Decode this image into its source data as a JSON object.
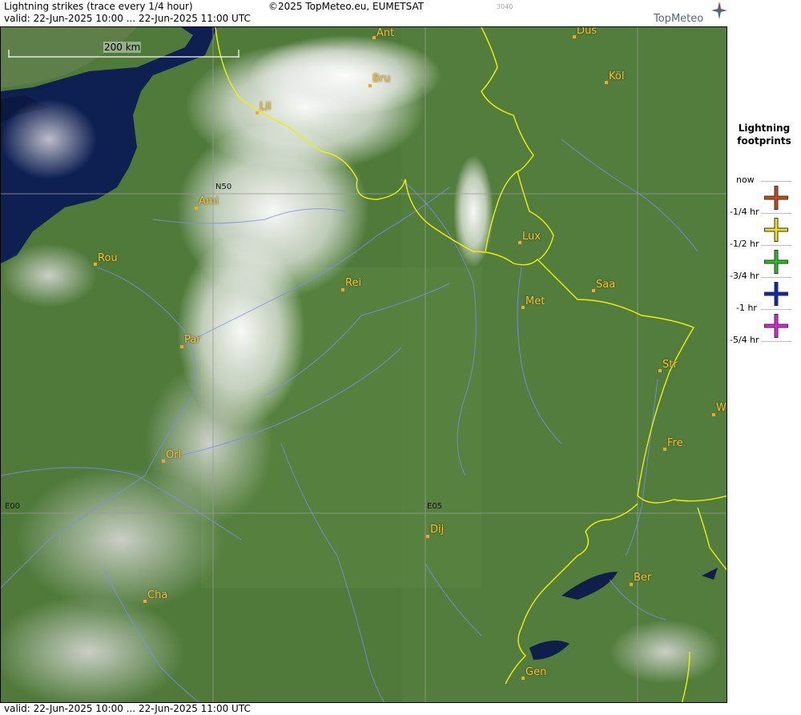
{
  "header": {
    "title": "Lightning strikes (trace every 1/4 hour)",
    "valid": "valid:  22-Jun-2025 10:00 ... 22-Jun-2025 11:00 UTC",
    "copyright": "©2025 TopMeteo.eu, EUMETSAT",
    "code": "3040",
    "brand": "TopMeteo"
  },
  "footer": {
    "valid": "valid:  22-Jun-2025 10:00 ... 22-Jun-2025 11:00 UTC"
  },
  "map": {
    "scale_label": "200 km",
    "grid_labels": {
      "n50": "N50",
      "e00": "E00",
      "e05": "E05"
    },
    "cities": [
      {
        "name": "Ant",
        "key": "ant"
      },
      {
        "name": "Düs",
        "key": "dus"
      },
      {
        "name": "Köl",
        "key": "kol"
      },
      {
        "name": "Bru",
        "key": "bru"
      },
      {
        "name": "Lil",
        "key": "lil"
      },
      {
        "name": "Ami",
        "key": "ami"
      },
      {
        "name": "Rou",
        "key": "rou"
      },
      {
        "name": "Lux",
        "key": "lux"
      },
      {
        "name": "Rei",
        "key": "rei"
      },
      {
        "name": "Saa",
        "key": "saa"
      },
      {
        "name": "Met",
        "key": "met"
      },
      {
        "name": "Par",
        "key": "par"
      },
      {
        "name": "Str",
        "key": "str"
      },
      {
        "name": "W",
        "key": "w"
      },
      {
        "name": "Fre",
        "key": "fre"
      },
      {
        "name": "Orl",
        "key": "orl"
      },
      {
        "name": "Dij",
        "key": "dij"
      },
      {
        "name": "Ber",
        "key": "ber"
      },
      {
        "name": "Cha",
        "key": "cha"
      },
      {
        "name": "Gen",
        "key": "gen"
      }
    ]
  },
  "legend": {
    "title_line1": "Lightning",
    "title_line2": "footprints",
    "entries": [
      {
        "label": "now",
        "color": ""
      },
      {
        "label": "-1/4 hr",
        "color": "#c84a14"
      },
      {
        "label": "-1/2 hr",
        "color": "#e8e020"
      },
      {
        "label": "-3/4 hr",
        "color": "#22c020"
      },
      {
        "label": "-1 hr",
        "color": "#1020c0"
      },
      {
        "label": "-5/4 hr",
        "color": "#e020e0"
      }
    ]
  },
  "colors": {
    "border": "#f0f000",
    "river": "#7b8cff",
    "city": "#f5c230"
  }
}
